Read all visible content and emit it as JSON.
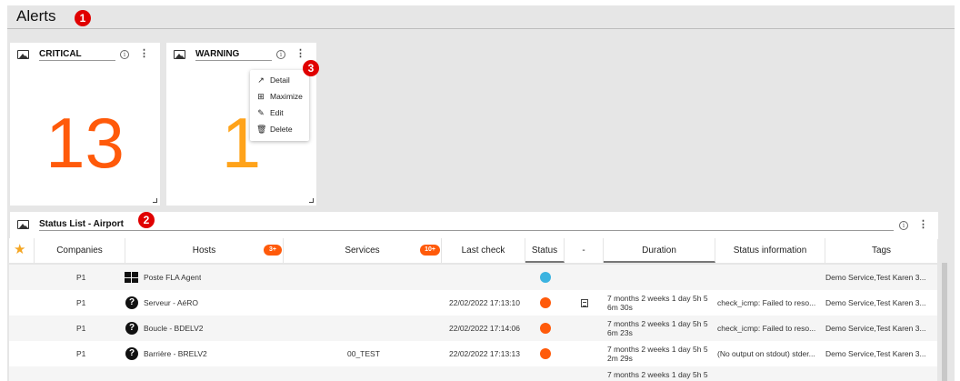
{
  "page": {
    "title": "Alerts"
  },
  "markers": [
    "1",
    "2",
    "3"
  ],
  "widgets": {
    "critical": {
      "title": "CRITICAL",
      "value": "13",
      "color": "#ff5a0a",
      "info_icon": "info-icon",
      "menu_icon": "kebab-icon"
    },
    "warning": {
      "title": "WARNING",
      "value": "1",
      "color": "#ffa31a",
      "info_icon": "info-icon",
      "menu_icon": "kebab-icon"
    }
  },
  "context_menu": {
    "items": [
      {
        "icon": "external-link-icon",
        "label": "Detail"
      },
      {
        "icon": "maximize-icon",
        "label": "Maximize"
      },
      {
        "icon": "pencil-icon",
        "label": "Edit"
      },
      {
        "icon": "trash-icon",
        "label": "Delete"
      }
    ]
  },
  "status_list": {
    "title": "Status List - Airport",
    "columns": {
      "companies": "Companies",
      "hosts": "Hosts",
      "hosts_badge": "3+",
      "services": "Services",
      "services_badge": "10+",
      "last_check": "Last check",
      "status": "Status",
      "dash": "-",
      "duration": "Duration",
      "status_information": "Status information",
      "tags": "Tags"
    },
    "status_colors": {
      "ok": "#3bb3e0",
      "critical": "#ff5a0a"
    },
    "rows": [
      {
        "company": "P1",
        "host_icon": "windows-icon",
        "host": "Poste FLA Agent",
        "service": "",
        "last_check": "",
        "status": "ok",
        "doc": false,
        "duration": "",
        "info": "",
        "tags": "Demo Service,Test Karen 3..."
      },
      {
        "company": "P1",
        "host_icon": "question-icon",
        "host": "Serveur - AéRO",
        "service": "",
        "last_check": "22/02/2022 17:13:10",
        "status": "critical",
        "doc": true,
        "duration": "7 months 2 weeks 1 day 5h 5 6m 30s",
        "info": "check_icmp: Failed to reso...",
        "tags": "Demo Service,Test Karen 3..."
      },
      {
        "company": "P1",
        "host_icon": "question-icon",
        "host": "Boucle - BDELV2",
        "service": "",
        "last_check": "22/02/2022 17:14:06",
        "status": "critical",
        "doc": false,
        "duration": "7 months 2 weeks 1 day 5h 5 6m 23s",
        "info": "check_icmp: Failed to reso...",
        "tags": "Demo Service,Test Karen 3..."
      },
      {
        "company": "P1",
        "host_icon": "question-icon",
        "host": "Barrière - BRELV2",
        "service": "00_TEST",
        "last_check": "22/02/2022 17:13:13",
        "status": "critical",
        "doc": false,
        "duration": "7 months 2 weeks 1 day 5h 5 2m 29s",
        "info": "(No output on stdout) stder...",
        "tags": "Demo Service,Test Karen 3..."
      }
    ],
    "partial_row": {
      "duration": "7 months 2 weeks 1 day 5h 5"
    }
  }
}
